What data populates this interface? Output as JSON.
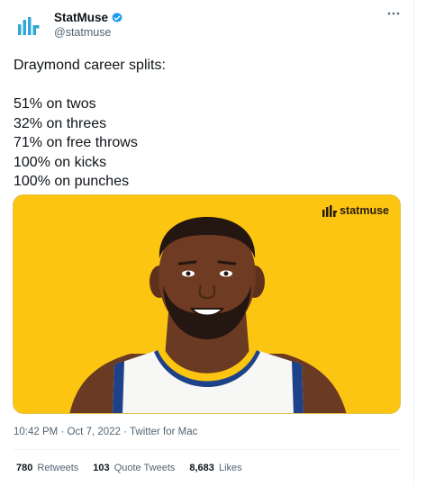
{
  "author": {
    "display_name": "StatMuse",
    "handle": "@statmuse",
    "verified_icon": "verified-badge-icon",
    "avatar_icon": "statmuse-logo-icon"
  },
  "more_icon": "more-options-icon",
  "tweet": {
    "lines": [
      "Draymond career splits:",
      "",
      "51% on twos",
      "32% on threes",
      "71% on free throws",
      "100% on kicks",
      "100% on punches"
    ]
  },
  "media": {
    "watermark_text": "statmuse",
    "background_color": "#fcc511",
    "jersey_color": "#1d428a"
  },
  "meta": {
    "time": "10:42 PM",
    "date": "Oct 7, 2022",
    "source": "Twitter for Mac",
    "separator": "·"
  },
  "stats": {
    "retweets_count": "780",
    "retweets_label": "Retweets",
    "quotes_count": "103",
    "quotes_label": "Quote Tweets",
    "likes_count": "8,683",
    "likes_label": "Likes"
  },
  "colors": {
    "verified": "#1d9bf0",
    "secondary_text": "#536471"
  }
}
